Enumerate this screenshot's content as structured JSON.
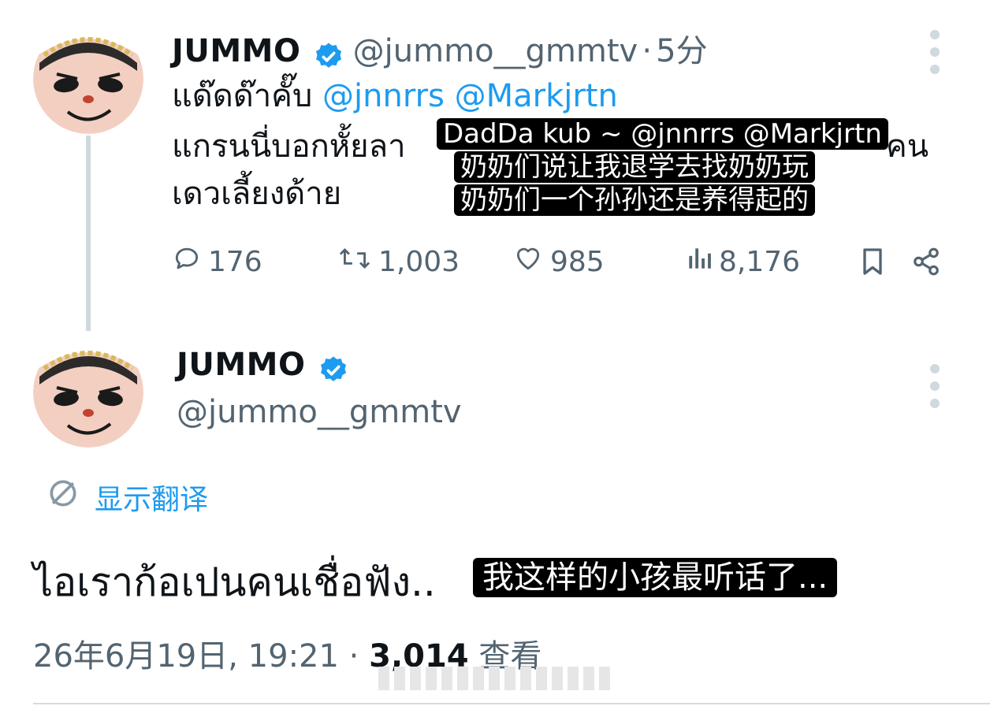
{
  "tweet1": {
    "name": "JUMMO",
    "handle": "@jummo__gmmtv",
    "separator": "·",
    "time": "5分",
    "line1": "แด๊ดด๊าคั๊บ",
    "mention1": "@jnnrrs",
    "mention2": "@Markjrtn",
    "line2_start": "แกรนนี่บอกหั้ยลา",
    "line2_end": "คน",
    "line3": "เดวเลี้ยงด้าย",
    "subtitles": [
      "DadDa kub ~ @jnnrrs @Markjrtn",
      "奶奶们说让我退学去找奶奶玩",
      "奶奶们一个孙孙还是养得起的"
    ],
    "actions": {
      "replies": "176",
      "retweets": "1,003",
      "likes": "985",
      "views": "8,176"
    }
  },
  "tweet2": {
    "name": "JUMMO",
    "handle": "@jummo__gmmtv",
    "translate_label": "显示翻译",
    "text": "ไอเราก้อเปนคนเชื่อฟัง..",
    "subtitle": "我这样的小孩最听话了...",
    "date": "26年6月19日, 19:21",
    "separator": "·",
    "views_count": "3,014",
    "views_label": "查看"
  },
  "colors": {
    "verified": "#1d9bf0",
    "link": "#1d9bf0",
    "secondary": "#536471"
  }
}
